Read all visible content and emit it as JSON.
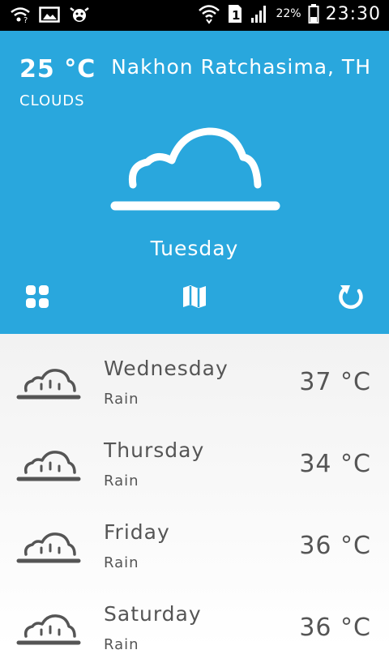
{
  "status_bar": {
    "battery_percent": "22%",
    "time": "23:30",
    "sim_slot": "1",
    "icons": [
      "wifi-question-icon",
      "image-icon",
      "cow-icon",
      "wifi-icon",
      "sim-icon",
      "signal-icon",
      "battery-icon"
    ]
  },
  "current": {
    "temperature": "25 °C",
    "condition": "CLOUDS",
    "location": "Nakhon Ratchasima, TH",
    "day": "Tuesday",
    "icon": "cloud-icon"
  },
  "toolbar": {
    "icons": [
      "grid-icon",
      "map-icon",
      "refresh-icon"
    ]
  },
  "forecast": [
    {
      "day": "Wednesday",
      "condition": "Rain",
      "temperature": "37 °C",
      "icon": "rain-cloud-icon"
    },
    {
      "day": "Thursday",
      "condition": "Rain",
      "temperature": "34 °C",
      "icon": "rain-cloud-icon"
    },
    {
      "day": "Friday",
      "condition": "Rain",
      "temperature": "36 °C",
      "icon": "rain-cloud-icon"
    },
    {
      "day": "Saturday",
      "condition": "Rain",
      "temperature": "36 °C",
      "icon": "rain-cloud-icon"
    }
  ],
  "colors": {
    "header_bg": "#29a7dd",
    "status_bar_bg": "#000000",
    "forecast_text": "#555555"
  }
}
